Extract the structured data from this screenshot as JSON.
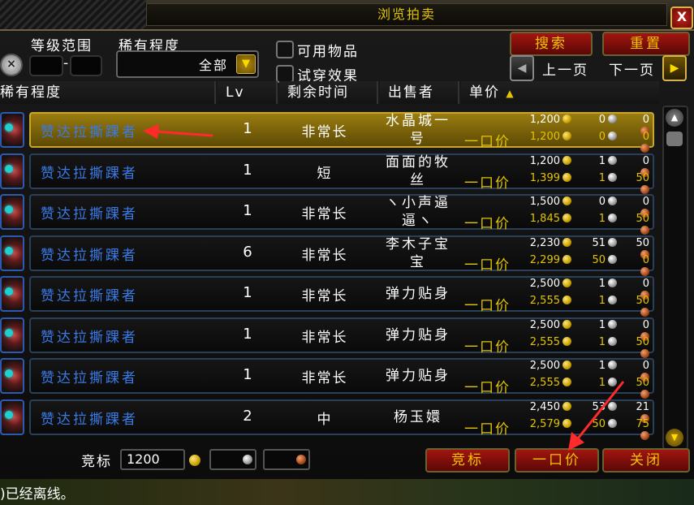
{
  "window": {
    "title": "浏览拍卖",
    "close_label": "X"
  },
  "filters": {
    "level_range_label": "等级范围",
    "level_sep": "-",
    "rarity_label": "稀有程度",
    "rarity_value": "全部",
    "usable_label": "可用物品",
    "tryon_label": "试穿效果"
  },
  "buttons": {
    "search": "搜索",
    "reset": "重置",
    "prev_page": "上一页",
    "next_page": "下一页",
    "bid": "竞标",
    "buyout": "一口价",
    "close": "关闭"
  },
  "columns": {
    "rarity": "稀有程度",
    "level": "Lv",
    "time_left": "剩余时间",
    "seller": "出售者",
    "unit_price": "单价",
    "sort_icon": "up-arrow-icon"
  },
  "buyout_label": "一口价",
  "rows": [
    {
      "name": "赞达拉撕踝者",
      "level": "1",
      "time": "非常长",
      "seller": "水晶城一号",
      "bid": [
        "1,200",
        "0",
        "0"
      ],
      "buyout": [
        "1,200",
        "0",
        "0"
      ],
      "selected": true
    },
    {
      "name": "赞达拉撕踝者",
      "level": "1",
      "time": "短",
      "seller": "面面的牧丝",
      "bid": [
        "1,200",
        "1",
        "0"
      ],
      "buyout": [
        "1,399",
        "1",
        "50"
      ],
      "selected": false
    },
    {
      "name": "赞达拉撕踝者",
      "level": "1",
      "time": "非常长",
      "seller": "ヽ小声逼逼ヽ",
      "bid": [
        "1,500",
        "0",
        "0"
      ],
      "buyout": [
        "1,845",
        "1",
        "50"
      ],
      "selected": false
    },
    {
      "name": "赞达拉撕踝者",
      "level": "6",
      "time": "非常长",
      "seller": "李木子宝宝",
      "bid": [
        "2,230",
        "51",
        "50"
      ],
      "buyout": [
        "2,299",
        "50",
        "0"
      ],
      "selected": false
    },
    {
      "name": "赞达拉撕踝者",
      "level": "1",
      "time": "非常长",
      "seller": "弹力贴身",
      "bid": [
        "2,500",
        "1",
        "0"
      ],
      "buyout": [
        "2,555",
        "1",
        "50"
      ],
      "selected": false
    },
    {
      "name": "赞达拉撕踝者",
      "level": "1",
      "time": "非常长",
      "seller": "弹力贴身",
      "bid": [
        "2,500",
        "1",
        "0"
      ],
      "buyout": [
        "2,555",
        "1",
        "50"
      ],
      "selected": false
    },
    {
      "name": "赞达拉撕踝者",
      "level": "1",
      "time": "非常长",
      "seller": "弹力贴身",
      "bid": [
        "2,500",
        "1",
        "0"
      ],
      "buyout": [
        "2,555",
        "1",
        "50"
      ],
      "selected": false
    },
    {
      "name": "赞达拉撕踝者",
      "level": "2",
      "time": "中",
      "seller": "杨玉嬛",
      "bid": [
        "2,450",
        "53",
        "21"
      ],
      "buyout": [
        "2,579",
        "50",
        "75"
      ],
      "selected": false
    }
  ],
  "bid_input": {
    "label": "竞标",
    "gold": "1200",
    "silver": "",
    "copper": ""
  },
  "chat": {
    "text": ")已经离线。"
  },
  "colors": {
    "accent_yellow": "#e3c400",
    "name_blue": "#3a7ae6",
    "button_red": "#a21510",
    "annotation_red": "#ff2a2a"
  }
}
